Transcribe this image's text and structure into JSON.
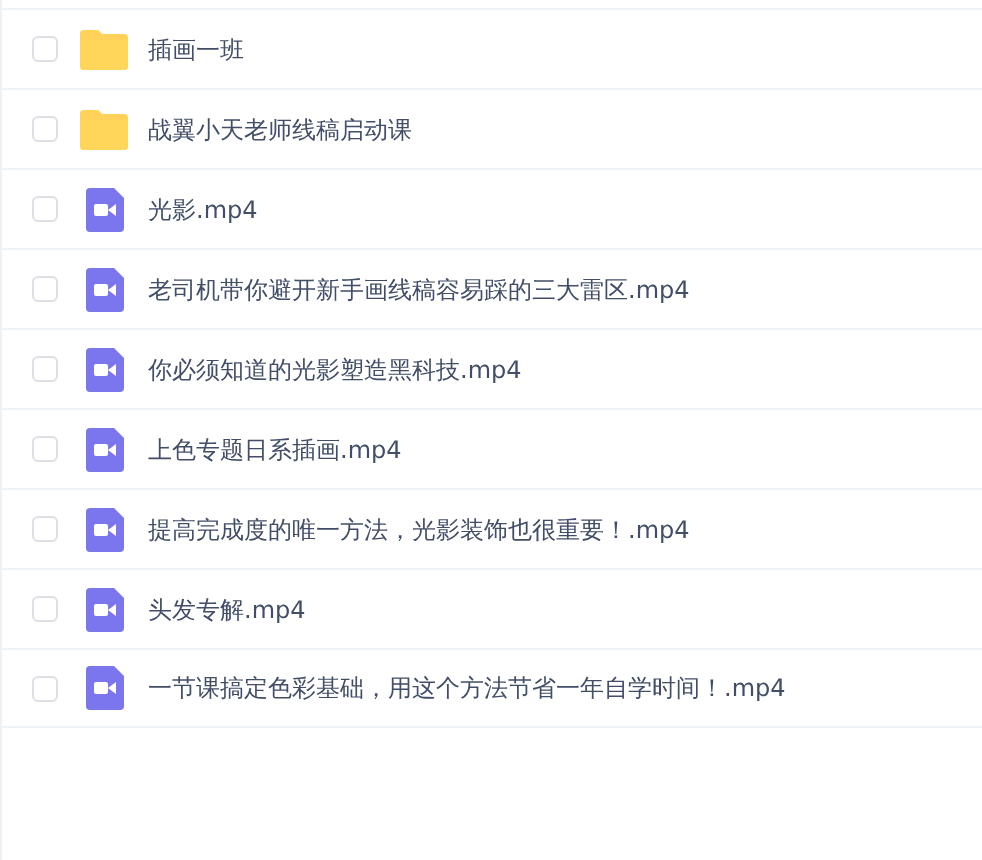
{
  "files": [
    {
      "kind": "folder",
      "name": "插画一班",
      "checked": false
    },
    {
      "kind": "folder",
      "name": "战翼小天老师线稿启动课",
      "checked": false
    },
    {
      "kind": "video",
      "name": "光影.mp4",
      "checked": false
    },
    {
      "kind": "video",
      "name": "老司机带你避开新手画线稿容易踩的三大雷区.mp4",
      "checked": false
    },
    {
      "kind": "video",
      "name": "你必须知道的光影塑造黑科技.mp4",
      "checked": false
    },
    {
      "kind": "video",
      "name": "上色专题日系插画.mp4",
      "checked": false
    },
    {
      "kind": "video",
      "name": "提高完成度的唯一方法，光影装饰也很重要！.mp4",
      "checked": false
    },
    {
      "kind": "video",
      "name": "头发专解.mp4",
      "checked": false
    },
    {
      "kind": "video",
      "name": "一节课搞定色彩基础，用这个方法节省一年自学时间！.mp4",
      "checked": false
    }
  ]
}
